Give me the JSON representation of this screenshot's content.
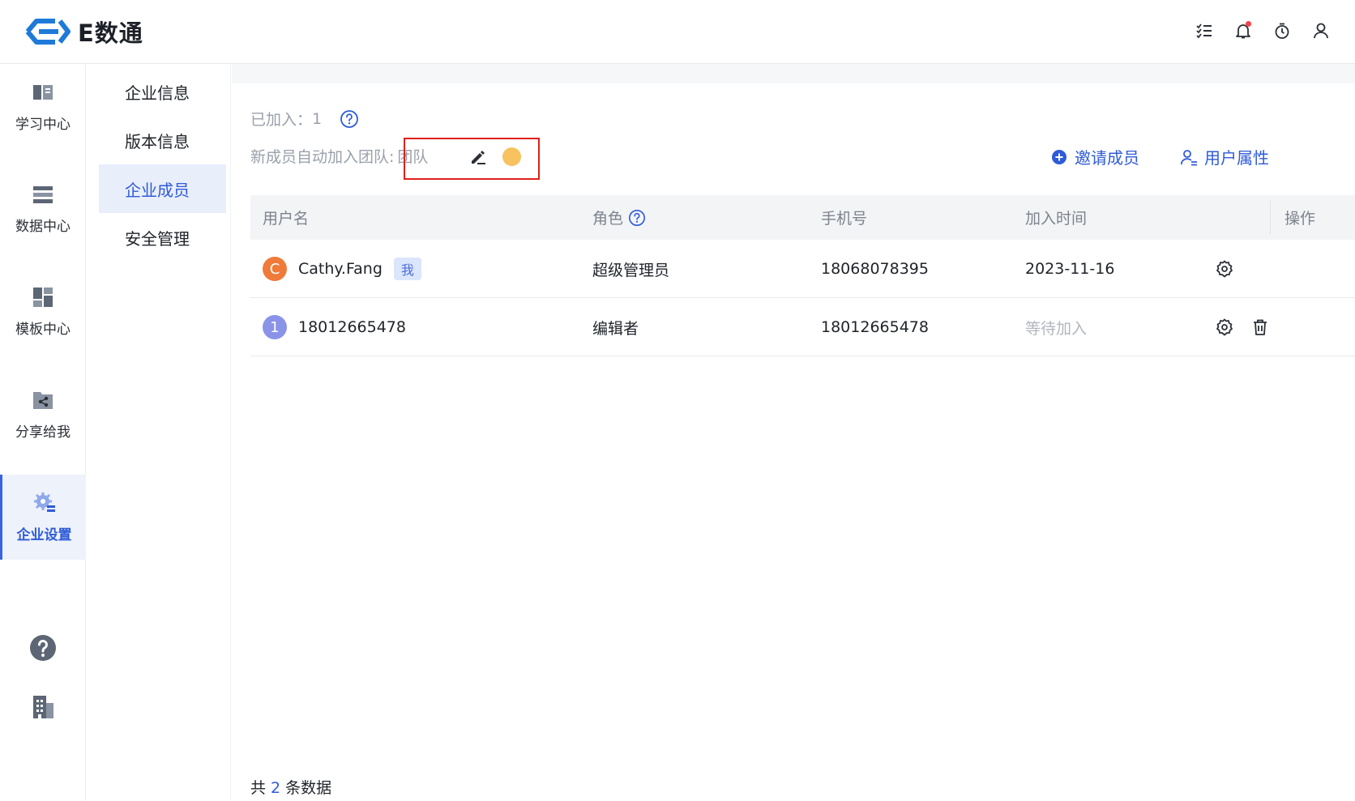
{
  "app": {
    "logo_text": "E数通",
    "brand_color": "#1e7ad9",
    "accent_color": "#2f5bd8"
  },
  "header": {
    "icons": [
      "task-list-icon",
      "bell-icon",
      "timer-icon",
      "user-icon"
    ]
  },
  "rail": {
    "items": [
      {
        "label": "学习中心",
        "icon": "book-icon"
      },
      {
        "label": "数据中心",
        "icon": "database-icon"
      },
      {
        "label": "模板中心",
        "icon": "template-icon"
      },
      {
        "label": "分享给我",
        "icon": "share-icon"
      },
      {
        "label": "企业设置",
        "icon": "settings-icon",
        "active": true
      }
    ],
    "bottom_icons": [
      "help-icon",
      "building-icon"
    ]
  },
  "subnav": {
    "items": [
      {
        "label": "企业信息"
      },
      {
        "label": "版本信息"
      },
      {
        "label": "企业成员",
        "active": true
      },
      {
        "label": "安全管理"
      }
    ]
  },
  "main": {
    "joined_label": "已加入：",
    "joined_count": "1",
    "auto_join_label": "新成员自动加入团队:",
    "auto_join_team": "团队",
    "invite_label": "邀请成员",
    "user_attr_label": "用户属性"
  },
  "table": {
    "headers": {
      "username": "用户名",
      "role": "角色",
      "phone": "手机号",
      "joined_at": "加入时间",
      "actions": "操作"
    },
    "rows": [
      {
        "avatar": "C",
        "avatar_color": "#f07a3a",
        "username": "Cathy.Fang",
        "tag": "我",
        "role": "超级管理员",
        "phone": "18068078395",
        "joined_at": "2023-11-16",
        "pending": false
      },
      {
        "avatar": "1",
        "avatar_color": "#8b93e8",
        "username": "18012665478",
        "tag": "",
        "role": "编辑者",
        "phone": "18012665478",
        "joined_at": "等待加入",
        "pending": true
      }
    ]
  },
  "footer": {
    "prefix": "共",
    "count": "2",
    "suffix": "条数据"
  }
}
